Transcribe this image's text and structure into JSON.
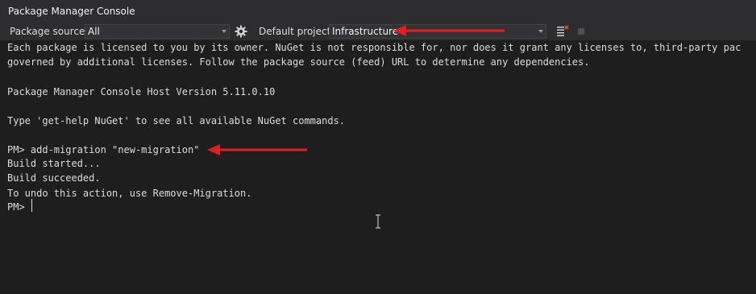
{
  "window": {
    "title": "Package Manager Console"
  },
  "toolbar": {
    "package_source_label": "Package source:",
    "package_source_value": "All",
    "settings_icon": "gear-icon",
    "default_project_label": "Default project:",
    "default_project_value": "Infrastructure",
    "clear_icon": "clear-console-icon",
    "stop_icon": "stop-icon"
  },
  "console": {
    "lines": [
      "Each package is licensed to you by its owner. NuGet is not responsible for, nor does it grant any licenses to, third-party pac",
      "governed by additional licenses. Follow the package source (feed) URL to determine any dependencies.",
      "",
      "Package Manager Console Host Version 5.11.0.10",
      "",
      "Type 'get-help NuGet' to see all available NuGet commands.",
      "",
      "PM> add-migration \"new-migration\"",
      "Build started...",
      "Build succeeded.",
      "To undo this action, use Remove-Migration.",
      "PM> "
    ]
  },
  "colors": {
    "background": "#1e1e1e",
    "toolbar": "#2d2d30",
    "text": "#dcdcdc",
    "annotation_arrow": "#e02020"
  }
}
